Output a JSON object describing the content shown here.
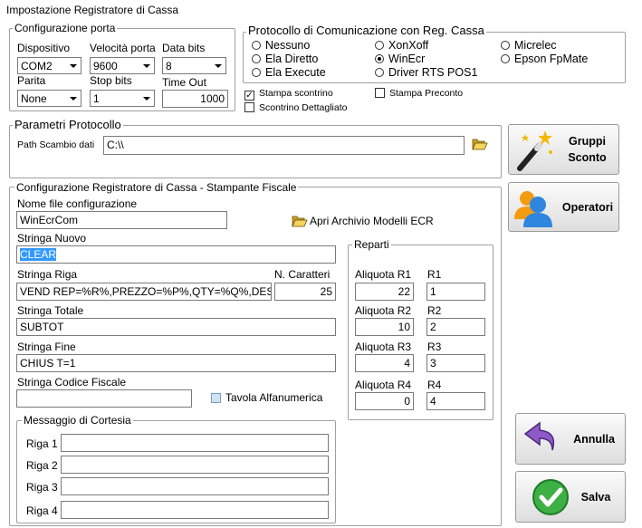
{
  "window": {
    "title": "Impostazione Registratore di Cassa"
  },
  "porta": {
    "title": "Configurazione porta",
    "dispositivo_label": "Dispositivo",
    "dispositivo_value": "COM2",
    "velocita_label": "Velocità porta",
    "velocita_value": "9600",
    "databits_label": "Data bits",
    "databits_value": "8",
    "parita_label": "Parita",
    "parita_value": "None",
    "stopbits_label": "Stop bits",
    "stopbits_value": "1",
    "timeout_label": "Time Out",
    "timeout_value": "1000"
  },
  "protocollo": {
    "title": "Protocollo di Comunicazione con Reg. Cassa",
    "options": [
      "Nessuno",
      "XonXoff",
      "Micrelec",
      "Ela Diretto",
      "WinEcr",
      "Epson FpMate",
      "Ela Execute",
      "Driver RTS POS1"
    ],
    "selected": "WinEcr"
  },
  "checks": {
    "stampa_scontrino": "Stampa scontrino",
    "stampa_preconto": "Stampa Preconto",
    "scontrino_dettagliato": "Scontrino Dettagliato",
    "check_mark": "✓"
  },
  "parametri": {
    "title": "Parametri Protocollo",
    "path_label": "Path Scambio dati",
    "path_value": "C:\\\\"
  },
  "buttons": {
    "gruppi_sconto_line1": "Gruppi",
    "gruppi_sconto_line2": "Sconto",
    "operatori": "Operatori",
    "annulla": "Annulla",
    "salva": "Salva"
  },
  "config": {
    "title": "Configurazione Registratore di Cassa - Stampante Fiscale",
    "nome_file_label": "Nome file configurazione",
    "nome_file_value": "WinEcrCom",
    "apri_archivio": "Apri Archivio Modelli ECR",
    "stringa_nuovo_label": "Stringa Nuovo",
    "stringa_nuovo_value": "CLEAR",
    "stringa_riga_label": "Stringa Riga",
    "stringa_riga_value": "VEND REP=%R%,PREZZO=%P%,QTY=%Q%,DES",
    "n_caratteri_label": "N. Caratteri",
    "n_caratteri_value": "25",
    "stringa_totale_label": "Stringa Totale",
    "stringa_totale_value": "SUBTOT",
    "stringa_fine_label": "Stringa Fine",
    "stringa_fine_value": "CHIUS T=1",
    "stringa_cf_label": "Stringa Codice Fiscale",
    "stringa_cf_value": "",
    "tavola_alfanumerica": "Tavola Alfanumerica"
  },
  "reparti": {
    "title": "Reparti",
    "rows": [
      {
        "aliquota_label": "Aliquota R1",
        "aliquota_value": "22",
        "r_label": "R1",
        "r_value": "1"
      },
      {
        "aliquota_label": "Aliquota R2",
        "aliquota_value": "10",
        "r_label": "R2",
        "r_value": "2"
      },
      {
        "aliquota_label": "Aliquota R3",
        "aliquota_value": "4",
        "r_label": "R3",
        "r_value": "3"
      },
      {
        "aliquota_label": "Aliquota R4",
        "aliquota_value": "0",
        "r_label": "R4",
        "r_value": "4"
      }
    ]
  },
  "cortesia": {
    "title": "Messaggio di Cortesia",
    "rows": [
      {
        "label": "Riga 1",
        "value": ""
      },
      {
        "label": "Riga 2",
        "value": ""
      },
      {
        "label": "Riga 3",
        "value": ""
      },
      {
        "label": "Riga 4",
        "value": ""
      }
    ]
  },
  "colors": {
    "selection": "#3399ff",
    "border": "#a0a0a0"
  }
}
